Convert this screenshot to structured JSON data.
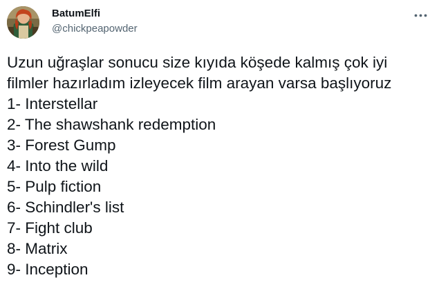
{
  "tweet": {
    "author": {
      "display_name": "BatumElfi",
      "handle": "@chickpeapowder",
      "avatar_icon": "profile-avatar"
    },
    "more_icon": "more-options-icon",
    "text_lines": [
      "Uzun uğraşlar sonucu size kıyıda köşede kalmış çok iyi",
      "filmler hazırladım izleyecek film arayan varsa başlıyoruz",
      "1- Interstellar",
      "2- The shawshank redemption",
      "3- Forest Gump",
      "4- Into the wild",
      "5- Pulp fiction",
      "6- Schindler's list",
      "7- Fight club",
      "8- Matrix",
      "9- Inception"
    ]
  },
  "colors": {
    "text_primary": "#0f1419",
    "text_secondary": "#536471",
    "background": "#ffffff"
  }
}
